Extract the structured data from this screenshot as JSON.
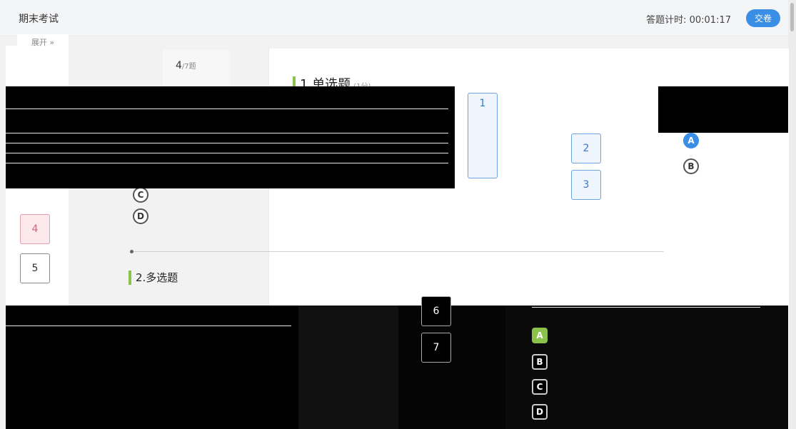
{
  "header": {
    "title": "期末考试",
    "timer": "答题计时: 00:01:17",
    "submit_label": "交卷"
  },
  "nav": {
    "expand_label": "展开 »"
  },
  "progress": {
    "current": "4",
    "total": "/7题"
  },
  "questions": [
    {
      "title": "1.单选题",
      "score": "(1分)"
    },
    {
      "title": "2.多选题",
      "score": ""
    }
  ],
  "question_numbers": [
    "1",
    "2",
    "3",
    "4",
    "5",
    "6",
    "7"
  ],
  "options_q1": [
    "A",
    "B",
    "C",
    "D"
  ],
  "options_q2": [
    "A",
    "B",
    "C",
    "D"
  ],
  "colors": {
    "accent": "#3a8ee6",
    "answered": "#8bc34a",
    "marked": "#e2a1ad"
  }
}
